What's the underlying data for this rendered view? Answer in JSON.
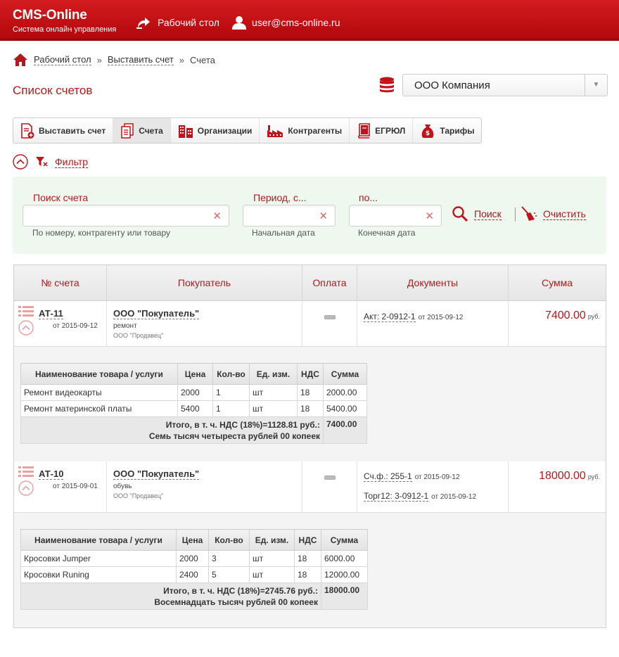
{
  "header": {
    "logo_title": "CMS-Online",
    "logo_subtitle": "Система онлайн управления",
    "desk_link": "Рабочий стол",
    "user_email": "user@cms-online.ru"
  },
  "breadcrumb": {
    "items": [
      "Рабочий стол",
      "Выставить счет",
      "Счета"
    ],
    "separator": "»"
  },
  "page_title": "Список счетов",
  "company_select": {
    "value": "ООО Компания"
  },
  "toolbar": {
    "items": [
      {
        "label": "Выставить счет",
        "icon": "new-invoice-icon"
      },
      {
        "label": "Счета",
        "icon": "documents-icon",
        "active": true
      },
      {
        "label": "Организации",
        "icon": "building-icon"
      },
      {
        "label": "Контрагенты",
        "icon": "factory-icon"
      },
      {
        "label": "ЕГРЮЛ",
        "icon": "book-icon"
      },
      {
        "label": "Тарифы",
        "icon": "money-bag-icon"
      }
    ]
  },
  "filter": {
    "toggle_label": "Фильтр",
    "search_label": "Поиск счета",
    "search_hint": "По номеру, контрагенту или товару",
    "period_from_label": "Период, с...",
    "period_from_hint": "Начальная дата",
    "period_to_label": "по...",
    "period_to_hint": "Конечная дата",
    "search_button": "Поиск",
    "clear_button": "Очистить"
  },
  "table": {
    "columns": [
      "№ счета",
      "Покупатель",
      "Оплата",
      "Документы",
      "Сумма"
    ],
    "invoices": [
      {
        "number": "АТ-11",
        "date": "от 2015-09-12",
        "buyer": "ООО \"Покупатель\"",
        "buyer_note": "ремонт",
        "seller": "ООО \"Продавец\"",
        "documents": [
          {
            "name": "Акт: 2-0912-1",
            "date": "от 2015-09-12"
          }
        ],
        "sum": "7400.00",
        "currency": "руб.",
        "items_header": [
          "Наименование товара / услуги",
          "Цена",
          "Кол-во",
          "Ед. изм.",
          "НДС",
          "Сумма"
        ],
        "items": [
          [
            "Ремонт видеокарты",
            "2000",
            "1",
            "шт",
            "18",
            "2000.00"
          ],
          [
            "Ремонт материнской платы",
            "5400",
            "1",
            "шт",
            "18",
            "5400.00"
          ]
        ],
        "total_line1": "Итого, в т. ч. НДС (18%)=1128.81 руб.:",
        "total_line2": "Семь тысяч четыреста рублей 00 копеек",
        "total_value": "7400.00"
      },
      {
        "number": "АТ-10",
        "date": "от 2015-09-01",
        "buyer": "ООО \"Покупатель\"",
        "buyer_note": "обувь",
        "seller": "ООО \"Продавец\"",
        "documents": [
          {
            "name": "Сч.ф.: 255-1",
            "date": "от 2015-09-12"
          },
          {
            "name": "Торг12: 3-0912-1",
            "date": "от 2015-09-12"
          }
        ],
        "sum": "18000.00",
        "currency": "руб.",
        "items_header": [
          "Наименование товара / услуги",
          "Цена",
          "Кол-во",
          "Ед. изм.",
          "НДС",
          "Сумма"
        ],
        "items": [
          [
            "Кросовки Jumper",
            "2000",
            "3",
            "шт",
            "18",
            "6000.00"
          ],
          [
            "Кросовки Runing",
            "2400",
            "5",
            "шт",
            "18",
            "12000.00"
          ]
        ],
        "total_line1": "Итого, в т. ч. НДС (18%)=2745.76 руб.:",
        "total_line2": "Восемнадцать тысяч рублей 00 копеек",
        "total_value": "18000.00"
      }
    ]
  },
  "colors": {
    "brand": "#c4111a",
    "accent_text": "#b3191c",
    "filter_bg": "#eef8ef"
  }
}
